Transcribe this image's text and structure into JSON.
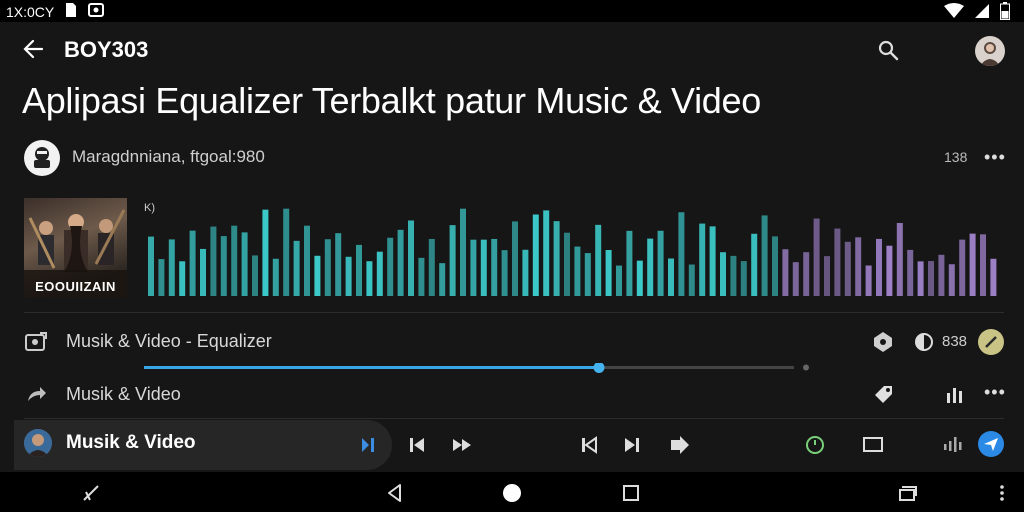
{
  "status_bar": {
    "time": "1X:0CY",
    "icons": [
      "notification-icon",
      "gallery-icon",
      "wifi-icon",
      "signal-icon",
      "battery-icon"
    ]
  },
  "header": {
    "app_name": "BOY303",
    "icons": [
      "back-arrow-icon",
      "search-icon",
      "profile-avatar"
    ]
  },
  "page_title": "Aplipasi Equalizer Terbalkt patur Music & Video",
  "author": {
    "name": "Maragdnniana, ftgoal:980",
    "count": "138",
    "more": "•••"
  },
  "cover": {
    "label": "EOOUIIZAIN"
  },
  "waveform": {
    "marker": "K)",
    "accent_cyan": "#3fd4d4",
    "accent_purple": "#a98ad6"
  },
  "equalizer_row": {
    "label": "Musik & Video - Equalizer",
    "value": "838",
    "progress": 0.7,
    "accent": "#3aa6e8"
  },
  "media_row": {
    "label": "Musik & Video",
    "more": "•••"
  },
  "now_playing": {
    "title": "Musik & Video"
  },
  "nav_bar": {
    "icons": [
      "recent-apps-icon",
      "back-icon",
      "home-icon",
      "overview-icon",
      "cast-icon",
      "menu-icon"
    ]
  }
}
